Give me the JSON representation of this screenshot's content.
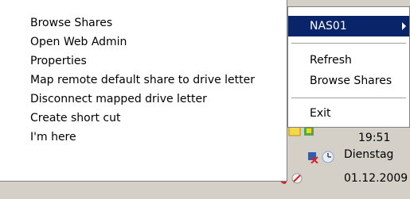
{
  "main_menu": {
    "items": [
      {
        "label": "Browse  Shares"
      },
      {
        "label": "Open Web Admin"
      },
      {
        "label": "Properties"
      },
      {
        "label": "Map remote default share to drive letter"
      },
      {
        "label": "Disconnect mapped drive letter"
      },
      {
        "label": "Create short cut"
      },
      {
        "label": "I'm here"
      }
    ]
  },
  "sub_menu": {
    "selected": {
      "label": "NAS01"
    },
    "items": [
      {
        "label": "Refresh"
      },
      {
        "label": "Browse Shares"
      },
      {
        "label": "Exit"
      }
    ]
  },
  "tray": {
    "time": "19:51",
    "day": "Dienstag",
    "date": "01.12.2009"
  }
}
